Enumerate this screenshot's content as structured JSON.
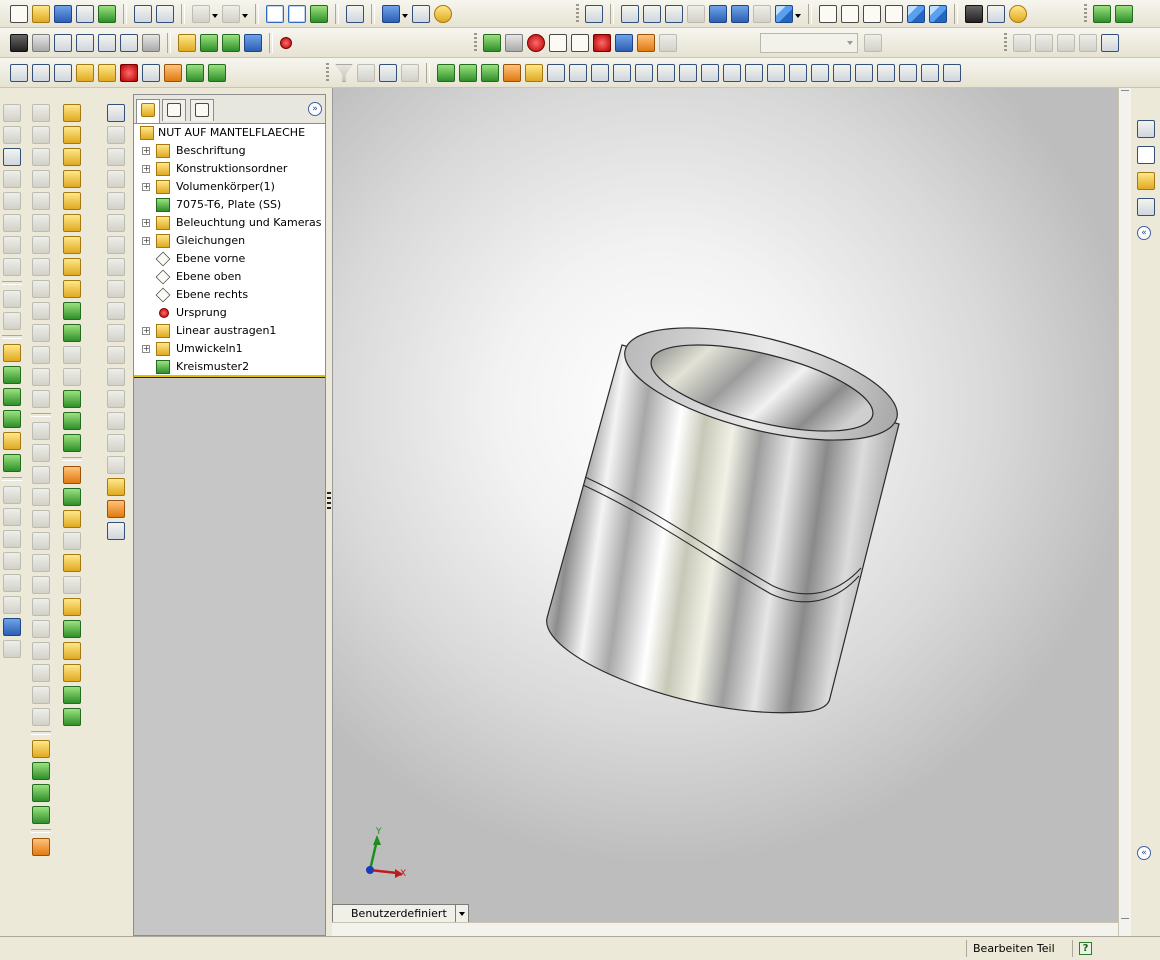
{
  "feature_tree": {
    "tabs": [
      {
        "name": "featuremanager-tab",
        "icon": "featuremanager-icon"
      },
      {
        "name": "propertymanager-tab",
        "icon": "propertymanager-icon"
      },
      {
        "name": "configurationmanager-tab",
        "icon": "configurationmanager-icon"
      }
    ],
    "root": "NUT AUF MANTELFLAECHE",
    "items": [
      {
        "label": "Beschriftung",
        "expandable": true,
        "icon": "annotation-icon"
      },
      {
        "label": "Konstruktionsordner",
        "expandable": true,
        "icon": "design-binder-icon"
      },
      {
        "label": "Volumenkörper(1)",
        "expandable": true,
        "icon": "solid-bodies-icon"
      },
      {
        "label": "7075-T6, Plate (SS)",
        "expandable": false,
        "icon": "material-icon"
      },
      {
        "label": "Beleuchtung und Kameras",
        "expandable": true,
        "icon": "lights-cameras-icon"
      },
      {
        "label": "Gleichungen",
        "expandable": true,
        "icon": "equations-icon"
      },
      {
        "label": "Ebene vorne",
        "expandable": false,
        "icon": "plane-icon"
      },
      {
        "label": "Ebene oben",
        "expandable": false,
        "icon": "plane-icon"
      },
      {
        "label": "Ebene rechts",
        "expandable": false,
        "icon": "plane-icon"
      },
      {
        "label": "Ursprung",
        "expandable": false,
        "icon": "origin-icon"
      },
      {
        "label": "Linear austragen1",
        "expandable": true,
        "icon": "extrude-icon"
      },
      {
        "label": "Umwickeln1",
        "expandable": true,
        "icon": "wrap-icon"
      },
      {
        "label": "Kreismuster2",
        "expandable": false,
        "icon": "circular-pattern-icon"
      }
    ]
  },
  "triad": {
    "y_label": "Y",
    "x_label": "X"
  },
  "configuration": {
    "label": "Benutzerdefiniert"
  },
  "status": {
    "mode": "Bearbeiten Teil",
    "help_icon": "help-icon"
  },
  "colors": {
    "accent": "#316ac5",
    "toolbar_bg": "#ece9d8",
    "tree_bg": "#ffffff",
    "selection_line": "#e0c000"
  }
}
